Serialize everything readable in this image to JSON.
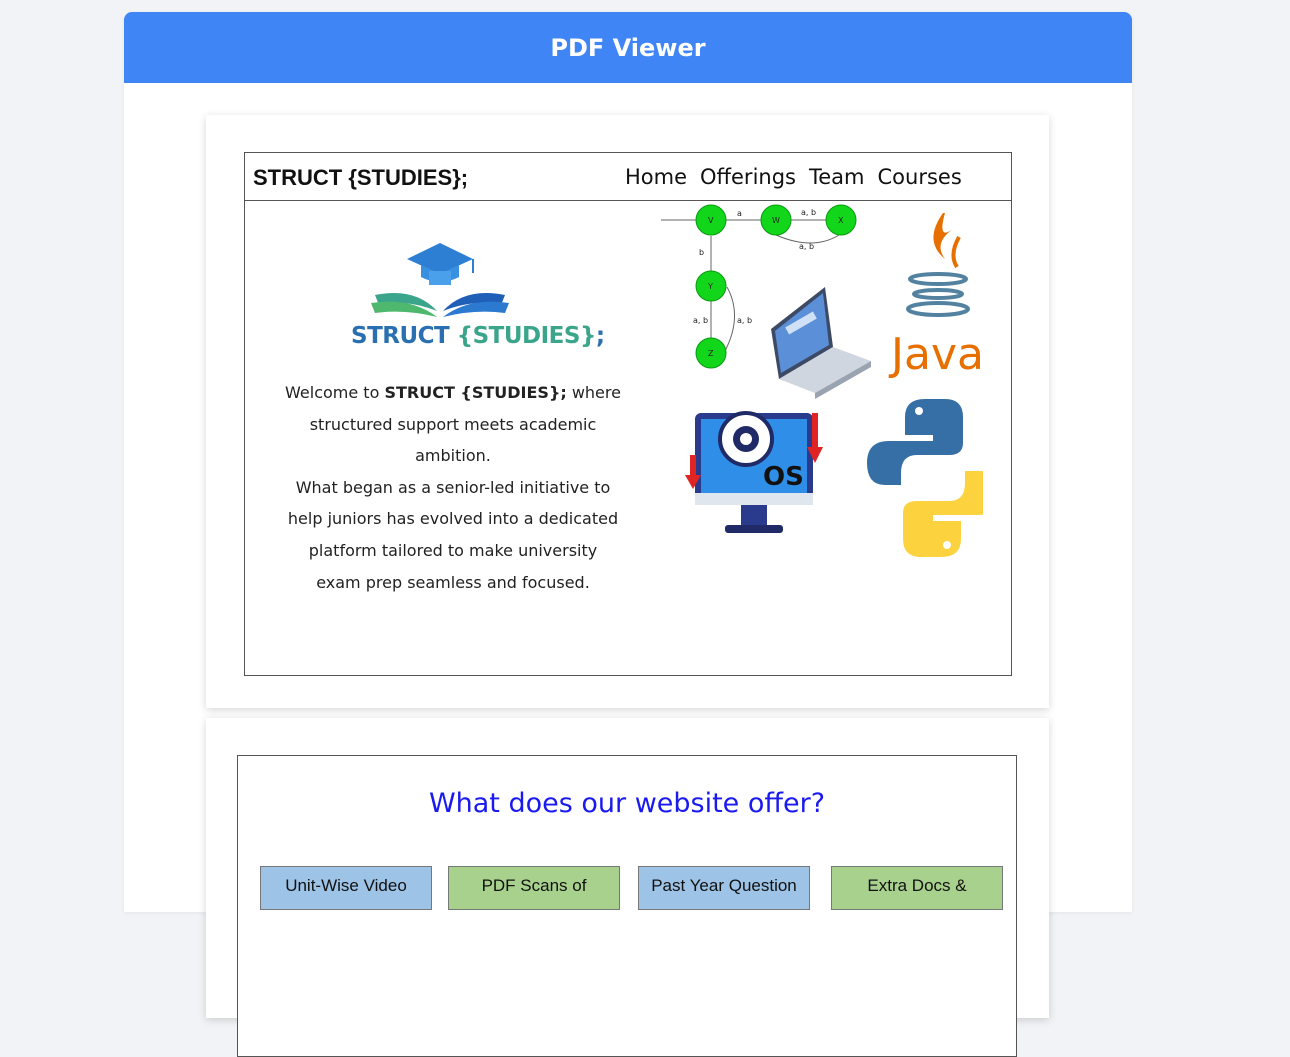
{
  "header": {
    "title": "PDF Viewer"
  },
  "page1": {
    "brand": "STRUCT {STUDIES};",
    "nav": [
      "Home",
      "Offerings",
      "Team",
      "Courses"
    ],
    "logo": {
      "part1": "STRUCT ",
      "part2": "{STUDIES}",
      "part3": ";"
    },
    "intro": {
      "line1_pre": "Welcome to ",
      "line1_bold": "STRUCT {STUDIES};",
      "line1_post": " where structured support meets academic ambition.",
      "line2": "What began as a senior-led initiative to help juniors has evolved into a dedicated platform tailored to make university exam prep seamless and focused."
    },
    "graphics": {
      "automaton_states": [
        "V",
        "W",
        "X",
        "Y",
        "Z"
      ],
      "automaton_edges": [
        "a",
        "a, b",
        "a, b",
        "b",
        "a, b",
        "a, b"
      ],
      "java_label": "Java",
      "os_label": "OS",
      "icons": [
        "automaton-diagram",
        "laptop-icon",
        "java-logo",
        "os-monitor-icon",
        "python-logo"
      ]
    }
  },
  "page2": {
    "title": "What does our website offer?",
    "offers": [
      "Unit-Wise Video",
      "PDF Scans of",
      "Past Year Question",
      "Extra Docs &"
    ]
  },
  "colors": {
    "header": "#3f85f6",
    "offer_title": "#1a1af0",
    "blue_box": "#9dc3e6",
    "green_box": "#a9d18e"
  }
}
